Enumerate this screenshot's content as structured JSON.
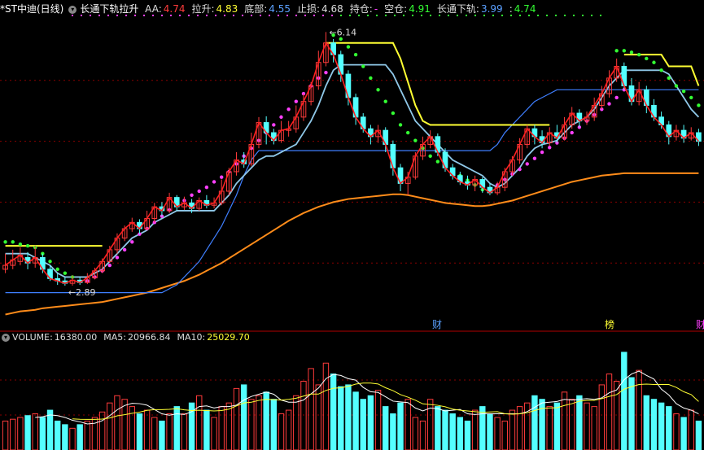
{
  "header": {
    "title": "*ST中迪(日线)",
    "indicator_name": "长通下轨拉升",
    "items": [
      {
        "label": "AA:",
        "value": "4.74",
        "color": "#ff3b3b"
      },
      {
        "label": "拉升:",
        "value": "4.83",
        "color": "#ffff33"
      },
      {
        "label": "底部:",
        "value": "4.55",
        "color": "#5aa0ff"
      },
      {
        "label": "止损:",
        "value": "4.68",
        "color": "#dddddd"
      },
      {
        "label": "持仓:",
        "value": "-",
        "color": "#ff40ff"
      },
      {
        "label": "空仓:",
        "value": "4.91",
        "color": "#33ff33"
      },
      {
        "label": "长通下轨:",
        "value": "3.99",
        "color": "#5aa0ff"
      },
      {
        "label": ":",
        "value": "4.74",
        "color": "#33ff33"
      }
    ]
  },
  "volume_header": {
    "items": [
      {
        "label": "VOLUME:",
        "value": "16380.00",
        "color": "#dddddd"
      },
      {
        "label": "MA5:",
        "value": "20966.84",
        "color": "#dddddd"
      },
      {
        "label": "MA10:",
        "value": "25029.70",
        "color": "#ffff33"
      }
    ]
  },
  "annotations": {
    "high_label": "6.14",
    "low_label": "2.89",
    "event_1": "财",
    "event_2": "榜",
    "event_3": "财"
  },
  "colors": {
    "up": "#ff3b3b",
    "down": "#54ffff",
    "close_line": "#ff2020",
    "yellow_band": "#ffff33",
    "light_band": "#8fc8e8",
    "blue_band": "#3f7fff",
    "orange_ma": "#ff8c1a",
    "green_dots": "#33ff33",
    "magenta_dots": "#ff40ff",
    "grid": "#8b0000",
    "ma5_vol": "#ffffff",
    "ma10_vol": "#ffff33"
  },
  "chart_data": {
    "type": "candlestick",
    "y_range": [
      2.4,
      6.3
    ],
    "candles": [
      [
        3.1,
        3.15,
        3.3,
        3.05
      ],
      [
        3.15,
        3.22,
        3.35,
        3.1
      ],
      [
        3.2,
        3.28,
        3.38,
        3.15
      ],
      [
        3.25,
        3.18,
        3.32,
        3.1
      ],
      [
        3.18,
        3.25,
        3.4,
        3.12
      ],
      [
        3.25,
        3.1,
        3.3,
        3.05
      ],
      [
        3.1,
        2.98,
        3.15,
        2.95
      ],
      [
        2.98,
        2.95,
        3.05,
        2.9
      ],
      [
        2.95,
        2.92,
        3.0,
        2.89
      ],
      [
        2.92,
        2.96,
        3.02,
        2.89
      ],
      [
        2.96,
        2.93,
        3.0,
        2.9
      ],
      [
        2.93,
        2.99,
        3.05,
        2.91
      ],
      [
        2.99,
        3.08,
        3.12,
        2.97
      ],
      [
        3.08,
        3.2,
        3.24,
        3.05
      ],
      [
        3.2,
        3.35,
        3.4,
        3.18
      ],
      [
        3.35,
        3.5,
        3.56,
        3.3
      ],
      [
        3.5,
        3.62,
        3.66,
        3.46
      ],
      [
        3.62,
        3.7,
        3.76,
        3.58
      ],
      [
        3.7,
        3.62,
        3.74,
        3.55
      ],
      [
        3.62,
        3.75,
        3.85,
        3.6
      ],
      [
        3.75,
        3.9,
        3.95,
        3.7
      ],
      [
        3.9,
        3.85,
        3.96,
        3.78
      ],
      [
        3.85,
        4.02,
        4.08,
        3.82
      ],
      [
        4.02,
        3.9,
        4.05,
        3.85
      ],
      [
        3.9,
        3.95,
        4.03,
        3.86
      ],
      [
        3.95,
        3.88,
        4.0,
        3.82
      ],
      [
        3.88,
        3.98,
        4.02,
        3.85
      ],
      [
        3.98,
        3.92,
        4.05,
        3.88
      ],
      [
        3.92,
        3.95,
        4.02,
        3.88
      ],
      [
        3.95,
        4.1,
        4.25,
        3.92
      ],
      [
        4.1,
        4.35,
        4.4,
        4.05
      ],
      [
        4.35,
        4.5,
        4.6,
        4.3
      ],
      [
        4.5,
        4.45,
        4.6,
        4.4
      ],
      [
        4.45,
        4.7,
        4.85,
        4.42
      ],
      [
        4.7,
        4.98,
        5.05,
        4.65
      ],
      [
        4.98,
        4.85,
        5.06,
        4.7
      ],
      [
        4.85,
        4.75,
        4.9,
        4.7
      ],
      [
        4.75,
        4.88,
        5.0,
        4.72
      ],
      [
        4.88,
        4.9,
        5.0,
        4.8
      ],
      [
        4.9,
        5.05,
        5.2,
        4.85
      ],
      [
        5.05,
        5.25,
        5.35,
        5.0
      ],
      [
        5.25,
        5.45,
        5.5,
        5.2
      ],
      [
        5.45,
        5.75,
        5.9,
        5.4
      ],
      [
        5.75,
        6.0,
        6.14,
        5.7
      ],
      [
        6.0,
        5.85,
        6.05,
        5.75
      ],
      [
        5.85,
        5.6,
        5.9,
        5.5
      ],
      [
        5.6,
        5.3,
        5.65,
        5.2
      ],
      [
        5.3,
        5.05,
        5.35,
        4.95
      ],
      [
        5.05,
        4.9,
        5.1,
        4.85
      ],
      [
        4.9,
        4.8,
        4.95,
        4.7
      ],
      [
        4.8,
        4.88,
        4.95,
        4.72
      ],
      [
        4.88,
        4.7,
        4.92,
        4.6
      ],
      [
        4.7,
        4.4,
        4.75,
        4.3
      ],
      [
        4.4,
        4.2,
        4.45,
        4.1
      ],
      [
        4.2,
        4.28,
        4.35,
        4.05
      ],
      [
        4.28,
        4.55,
        4.6,
        4.25
      ],
      [
        4.55,
        4.7,
        4.8,
        4.5
      ],
      [
        4.7,
        4.8,
        4.88,
        4.65
      ],
      [
        4.8,
        4.6,
        4.84,
        4.55
      ],
      [
        4.6,
        4.4,
        4.65,
        4.35
      ],
      [
        4.4,
        4.3,
        4.45,
        4.25
      ],
      [
        4.3,
        4.22,
        4.35,
        4.18
      ],
      [
        4.22,
        4.18,
        4.3,
        4.12
      ],
      [
        4.18,
        4.25,
        4.3,
        4.1
      ],
      [
        4.25,
        4.15,
        4.28,
        4.08
      ],
      [
        4.15,
        4.08,
        4.2,
        4.05
      ],
      [
        4.08,
        4.15,
        4.22,
        4.05
      ],
      [
        4.15,
        4.35,
        4.4,
        4.1
      ],
      [
        4.35,
        4.5,
        4.55,
        4.3
      ],
      [
        4.5,
        4.7,
        4.78,
        4.45
      ],
      [
        4.7,
        4.9,
        4.95,
        4.65
      ],
      [
        4.9,
        4.8,
        4.95,
        4.7
      ],
      [
        4.8,
        4.72,
        4.88,
        4.65
      ],
      [
        4.72,
        4.85,
        4.92,
        4.68
      ],
      [
        4.85,
        4.78,
        4.95,
        4.72
      ],
      [
        4.78,
        4.95,
        5.05,
        4.75
      ],
      [
        4.95,
        5.1,
        5.18,
        4.9
      ],
      [
        5.1,
        5.0,
        5.15,
        4.92
      ],
      [
        5.0,
        5.05,
        5.12,
        4.95
      ],
      [
        5.05,
        5.2,
        5.3,
        5.0
      ],
      [
        5.2,
        5.35,
        5.45,
        5.15
      ],
      [
        5.35,
        5.55,
        5.65,
        5.3
      ],
      [
        5.55,
        5.7,
        5.8,
        5.5
      ],
      [
        5.7,
        5.45,
        5.75,
        5.4
      ],
      [
        5.45,
        5.25,
        5.55,
        5.2
      ],
      [
        5.25,
        5.4,
        5.5,
        5.2
      ],
      [
        5.4,
        5.2,
        5.45,
        5.1
      ],
      [
        5.2,
        5.05,
        5.28,
        5.0
      ],
      [
        5.05,
        4.95,
        5.12,
        4.9
      ],
      [
        4.95,
        4.8,
        5.0,
        4.7
      ],
      [
        4.8,
        4.88,
        4.95,
        4.75
      ],
      [
        4.88,
        4.78,
        4.95,
        4.72
      ],
      [
        4.78,
        4.85,
        4.92,
        4.75
      ],
      [
        4.85,
        4.74,
        4.9,
        4.68
      ]
    ],
    "light_band": [
      3.3,
      3.3,
      3.3,
      3.3,
      3.25,
      3.2,
      3.15,
      3.05,
      3.0,
      3.0,
      3.0,
      3.0,
      3.05,
      3.1,
      3.2,
      3.3,
      3.4,
      3.5,
      3.55,
      3.6,
      3.7,
      3.75,
      3.8,
      3.85,
      3.85,
      3.85,
      3.85,
      3.85,
      3.85,
      3.95,
      4.05,
      4.2,
      4.3,
      4.4,
      4.5,
      4.55,
      4.55,
      4.6,
      4.65,
      4.7,
      4.85,
      5.0,
      5.2,
      5.45,
      5.65,
      5.72,
      5.72,
      5.72,
      5.72,
      5.72,
      5.72,
      5.72,
      5.6,
      5.4,
      5.2,
      5.0,
      4.9,
      4.8,
      4.7,
      4.6,
      4.5,
      4.45,
      4.4,
      4.35,
      4.3,
      4.2,
      4.15,
      4.2,
      4.3,
      4.4,
      4.55,
      4.65,
      4.7,
      4.72,
      4.75,
      4.85,
      4.95,
      5.0,
      5.05,
      5.15,
      5.3,
      5.45,
      5.55,
      5.65,
      5.65,
      5.65,
      5.65,
      5.65,
      5.65,
      5.6,
      5.45,
      5.3,
      5.15,
      5.05
    ],
    "yellow_band": [
      3.4,
      3.4,
      3.4,
      3.4,
      3.4,
      3.4,
      3.4,
      3.4,
      3.4,
      3.4,
      3.4,
      3.4,
      3.4,
      3.4,
      null,
      null,
      null,
      null,
      null,
      null,
      null,
      null,
      null,
      null,
      null,
      null,
      null,
      null,
      null,
      null,
      null,
      null,
      null,
      null,
      null,
      null,
      null,
      null,
      null,
      null,
      null,
      null,
      null,
      6.0,
      6.0,
      6.0,
      6.0,
      6.0,
      6.0,
      6.0,
      6.0,
      6.0,
      6.0,
      5.8,
      5.5,
      5.2,
      5.0,
      4.95,
      4.95,
      4.95,
      4.95,
      4.95,
      4.95,
      4.95,
      4.95,
      4.95,
      4.95,
      4.95,
      4.95,
      4.95,
      4.95,
      4.95,
      4.95,
      4.95,
      null,
      null,
      null,
      null,
      null,
      null,
      null,
      null,
      null,
      5.85,
      5.85,
      5.85,
      5.85,
      5.85,
      5.85,
      5.7,
      5.7,
      5.7,
      5.7,
      5.45
    ],
    "blue_band": [
      2.8,
      2.8,
      2.8,
      2.8,
      2.8,
      2.8,
      2.8,
      2.8,
      2.8,
      2.8,
      2.8,
      2.8,
      2.8,
      2.8,
      2.8,
      2.8,
      2.8,
      2.8,
      2.8,
      2.8,
      2.8,
      2.8,
      2.85,
      2.9,
      3.0,
      3.1,
      3.2,
      3.35,
      3.5,
      3.65,
      3.85,
      4.05,
      4.3,
      4.5,
      4.62,
      4.62,
      4.62,
      4.62,
      4.62,
      4.62,
      4.62,
      4.62,
      4.62,
      4.62,
      4.62,
      4.62,
      4.62,
      4.62,
      4.62,
      4.62,
      4.62,
      4.62,
      4.62,
      4.62,
      4.62,
      4.62,
      4.62,
      4.62,
      4.62,
      4.62,
      4.62,
      4.62,
      4.62,
      4.62,
      4.62,
      4.62,
      4.7,
      4.85,
      4.95,
      5.05,
      5.15,
      5.25,
      5.3,
      5.35,
      5.4,
      5.4,
      5.4,
      5.4,
      5.4,
      5.4,
      5.4,
      5.4,
      5.4,
      5.4,
      5.4,
      5.4,
      5.4,
      5.4,
      5.4,
      5.4,
      5.4,
      5.4,
      5.4,
      5.4
    ],
    "orange_ma": [
      2.52,
      2.54,
      2.56,
      2.57,
      2.58,
      2.6,
      2.61,
      2.62,
      2.63,
      2.64,
      2.65,
      2.66,
      2.67,
      2.68,
      2.7,
      2.72,
      2.74,
      2.76,
      2.78,
      2.8,
      2.83,
      2.86,
      2.89,
      2.92,
      2.95,
      2.99,
      3.03,
      3.08,
      3.13,
      3.18,
      3.24,
      3.3,
      3.36,
      3.42,
      3.48,
      3.54,
      3.6,
      3.66,
      3.72,
      3.77,
      3.82,
      3.86,
      3.9,
      3.93,
      3.96,
      3.98,
      4.0,
      4.01,
      4.02,
      4.03,
      4.04,
      4.05,
      4.06,
      4.06,
      4.05,
      4.03,
      4.01,
      3.99,
      3.97,
      3.95,
      3.94,
      3.93,
      3.92,
      3.91,
      3.91,
      3.92,
      3.94,
      3.96,
      3.98,
      4.01,
      4.04,
      4.07,
      4.1,
      4.13,
      4.16,
      4.19,
      4.22,
      4.24,
      4.26,
      4.28,
      4.3,
      4.31,
      4.32,
      4.33,
      4.33,
      4.33,
      4.33,
      4.33,
      4.33,
      4.33,
      4.33,
      4.33,
      4.33,
      4.33
    ],
    "green_dots": [
      3.45,
      3.45,
      3.42,
      3.4,
      3.38,
      3.3,
      3.2,
      3.1,
      3.05,
      3.0,
      null,
      null,
      null,
      null,
      null,
      null,
      null,
      null,
      null,
      null,
      null,
      null,
      null,
      null,
      null,
      null,
      null,
      null,
      null,
      null,
      null,
      null,
      null,
      null,
      null,
      null,
      null,
      null,
      null,
      null,
      null,
      null,
      null,
      null,
      6.1,
      6.05,
      5.95,
      5.85,
      5.7,
      5.55,
      5.4,
      5.25,
      5.1,
      4.95,
      4.85,
      4.75,
      4.65,
      4.55,
      4.48,
      4.42,
      4.36,
      4.3,
      4.24,
      4.18,
      4.12,
      null,
      null,
      null,
      null,
      null,
      null,
      null,
      null,
      null,
      null,
      null,
      null,
      null,
      null,
      null,
      null,
      null,
      5.9,
      5.9,
      5.88,
      5.85,
      5.8,
      5.75,
      5.65,
      5.55,
      5.45,
      5.38,
      5.3,
      5.2
    ],
    "magenta_dots": [
      null,
      null,
      null,
      null,
      null,
      null,
      null,
      null,
      null,
      null,
      null,
      2.95,
      3.0,
      3.08,
      3.15,
      3.25,
      3.35,
      3.45,
      3.55,
      3.62,
      3.7,
      3.78,
      3.86,
      3.92,
      3.98,
      4.05,
      4.1,
      4.15,
      4.22,
      4.28,
      4.35,
      4.45,
      4.55,
      4.65,
      4.75,
      4.85,
      4.95,
      5.05,
      5.15,
      5.25,
      5.35,
      5.45,
      5.55,
      5.62,
      null,
      null,
      null,
      null,
      null,
      null,
      null,
      null,
      null,
      null,
      null,
      null,
      null,
      null,
      null,
      null,
      null,
      null,
      null,
      null,
      null,
      4.12,
      4.18,
      4.25,
      4.32,
      4.38,
      4.45,
      4.52,
      4.6,
      4.66,
      4.72,
      4.78,
      4.85,
      4.92,
      5.0,
      5.08,
      5.15,
      5.22,
      5.3,
      5.4,
      null,
      null,
      null,
      null,
      null,
      null,
      null,
      null,
      null,
      null
    ],
    "volume": [
      16,
      17,
      18,
      19,
      20,
      18,
      22,
      16,
      14,
      12,
      14,
      16,
      18,
      21,
      26,
      30,
      28,
      24,
      20,
      22,
      18,
      16,
      20,
      24,
      20,
      26,
      30,
      22,
      18,
      24,
      26,
      34,
      36,
      28,
      30,
      32,
      28,
      20,
      22,
      30,
      38,
      45,
      36,
      48,
      42,
      35,
      36,
      32,
      28,
      30,
      33,
      24,
      20,
      26,
      28,
      18,
      16,
      28,
      24,
      22,
      20,
      18,
      16,
      22,
      24,
      20,
      18,
      16,
      22,
      24,
      26,
      30,
      28,
      24,
      26,
      32,
      28,
      30,
      26,
      24,
      36,
      42,
      38,
      54,
      40,
      44,
      30,
      28,
      26,
      24,
      20,
      18,
      22,
      16
    ],
    "volume_range": [
      0,
      58
    ]
  }
}
